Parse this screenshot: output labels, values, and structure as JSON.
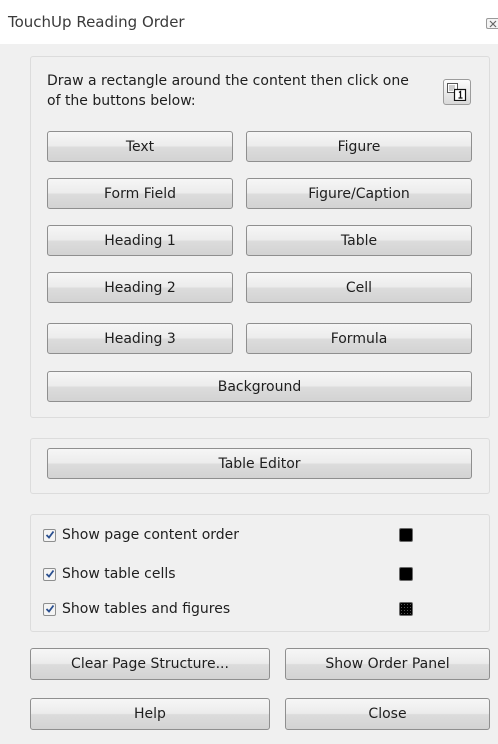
{
  "window": {
    "title": "TouchUp Reading Order"
  },
  "instructions": {
    "text": "Draw a rectangle around the content then click one of the buttons below:",
    "icon": "page-order-icon"
  },
  "tag_buttons": [
    {
      "label": "Text",
      "mnemonic": "x"
    },
    {
      "label": "Figure",
      "mnemonic": "g"
    },
    {
      "label": "Form Field",
      "mnemonic": "F"
    },
    {
      "label": "Figure/Caption",
      "mnemonic": "u"
    },
    {
      "label": "Heading 1",
      "mnemonic": "1"
    },
    {
      "label": "Table",
      "mnemonic": "T"
    },
    {
      "label": "Heading 2",
      "mnemonic": "2"
    },
    {
      "label": "Cell",
      "mnemonic": "e"
    },
    {
      "label": "Heading 3",
      "mnemonic": "3"
    },
    {
      "label": "Formula",
      "mnemonic": "r"
    },
    {
      "label": "Background",
      "mnemonic": "k"
    }
  ],
  "table_editor": {
    "label": "Table Editor",
    "mnemonic": "b"
  },
  "options": [
    {
      "label": "Show page content order",
      "checked": true,
      "swatch_color": "#000000"
    },
    {
      "label": "Show table cells",
      "checked": true,
      "swatch_color": "#000000"
    },
    {
      "label": "Show tables and figures",
      "checked": true,
      "swatch_color": "#000000"
    }
  ],
  "footer_buttons": {
    "clear": "Clear Page Structure...",
    "show_order": "Show Order Panel",
    "help": "Help",
    "close": "Close"
  }
}
